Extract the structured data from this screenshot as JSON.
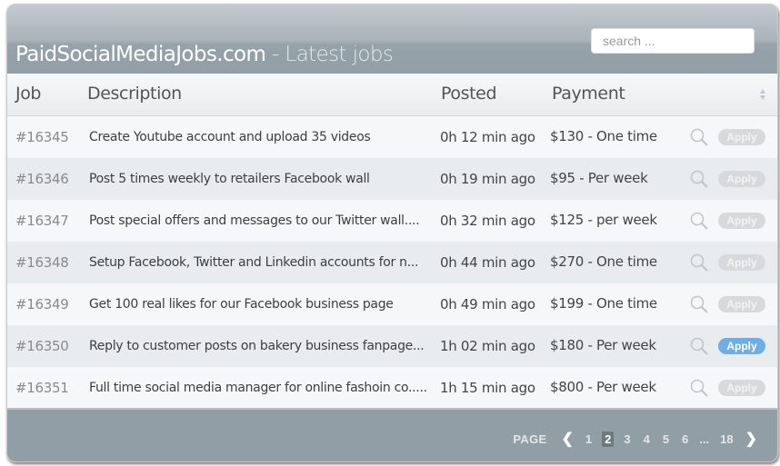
{
  "header": {
    "site_name": "PaidSocialMediaJobs.com",
    "subtitle": " - Latest jobs",
    "search_placeholder": "search ..."
  },
  "columns": {
    "job": "Job",
    "description": "Description",
    "posted": "Posted",
    "payment": "Payment"
  },
  "rows": [
    {
      "id": "#16345",
      "description": "Create Youtube account and upload 35 videos",
      "posted": "0h 12 min ago",
      "payment": "$130 - One time",
      "apply_label": "Apply",
      "apply_active": false
    },
    {
      "id": "#16346",
      "description": "Post 5 times weekly to retailers Facebook wall",
      "posted": "0h 19 min ago",
      "payment": "$95   - Per week",
      "apply_label": "Apply",
      "apply_active": false
    },
    {
      "id": "#16347",
      "description": "Post special offers and messages to our Twitter wall....",
      "posted": "0h 32 min ago",
      "payment": "$125 - per week",
      "apply_label": "Apply",
      "apply_active": false
    },
    {
      "id": "#16348",
      "description": "Setup Facebook, Twitter and Linkedin accounts for n...",
      "posted": "0h 44 min ago",
      "payment": "$270 - One time",
      "apply_label": "Apply",
      "apply_active": false
    },
    {
      "id": "#16349",
      "description": "Get 100 real likes for our Facebook business page",
      "posted": "0h 49 min ago",
      "payment": "$199 - One time",
      "apply_label": "Apply",
      "apply_active": false
    },
    {
      "id": "#16350",
      "description": "Reply to customer posts on bakery business fanpage...",
      "posted": "1h 02 min ago",
      "payment": "$180 - Per week",
      "apply_label": "Apply",
      "apply_active": true
    },
    {
      "id": "#16351",
      "description": "Full time social media manager for online fashoin co.....",
      "posted": "1h 15 min ago",
      "payment": "$800 - Per week",
      "apply_label": "Apply",
      "apply_active": false
    }
  ],
  "pagination": {
    "label": "PAGE",
    "prev_icon": "chevron-left-icon",
    "next_icon": "chevron-right-icon",
    "pages": [
      "1",
      "2",
      "3",
      "4",
      "5",
      "6"
    ],
    "current_page": "2",
    "ellipsis": "...",
    "last_page": "18"
  },
  "colors": {
    "header_bg": "#939fa7",
    "apply_active": "#6daee9",
    "apply_inactive": "#d8d9da"
  }
}
